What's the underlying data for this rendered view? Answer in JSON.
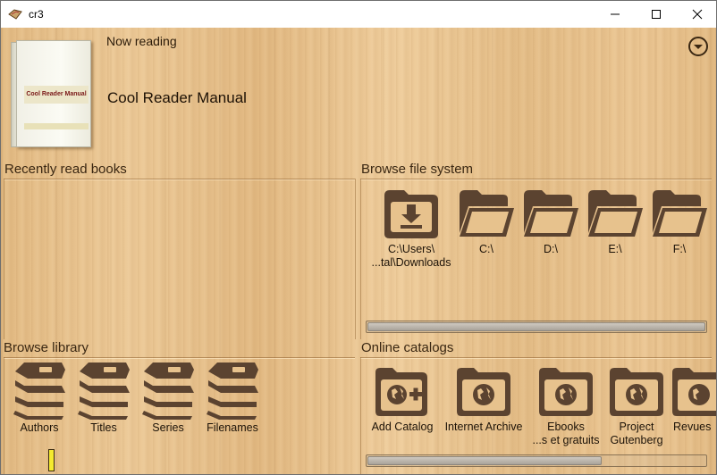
{
  "window": {
    "title": "cr3"
  },
  "now_reading": {
    "label": "Now reading",
    "book_title": "Cool Reader Manual",
    "cover_text": "Cool Reader Manual"
  },
  "sections": {
    "recent": {
      "title": "Recently read books"
    },
    "filesystem": {
      "title": "Browse file system",
      "items": [
        {
          "label": "C:\\Users\\",
          "label2": "...tal\\Downloads",
          "icon": "download-folder-icon"
        },
        {
          "label": "C:\\",
          "icon": "folder-icon"
        },
        {
          "label": "D:\\",
          "icon": "folder-icon"
        },
        {
          "label": "E:\\",
          "icon": "folder-icon"
        },
        {
          "label": "F:\\",
          "icon": "folder-icon"
        }
      ]
    },
    "library": {
      "title": "Browse library",
      "items": [
        {
          "label": "Authors",
          "icon": "books-icon"
        },
        {
          "label": "Titles",
          "icon": "books-icon"
        },
        {
          "label": "Series",
          "icon": "books-icon"
        },
        {
          "label": "Filenames",
          "icon": "books-icon"
        }
      ]
    },
    "catalogs": {
      "title": "Online catalogs",
      "items": [
        {
          "label": "Add Catalog",
          "icon": "add-catalog-icon"
        },
        {
          "label": "Internet Archive",
          "icon": "globe-folder-icon"
        },
        {
          "label": "Ebooks",
          "label2": "...s et gratuits",
          "icon": "globe-folder-icon"
        },
        {
          "label": "Project",
          "label2": "Gutenberg",
          "icon": "globe-folder-icon"
        },
        {
          "label": "Revues",
          "icon": "globe-folder-icon"
        }
      ]
    }
  },
  "colors": {
    "icon": "#5b4330",
    "wood": "#e7c28d",
    "text": "#1d1308"
  }
}
